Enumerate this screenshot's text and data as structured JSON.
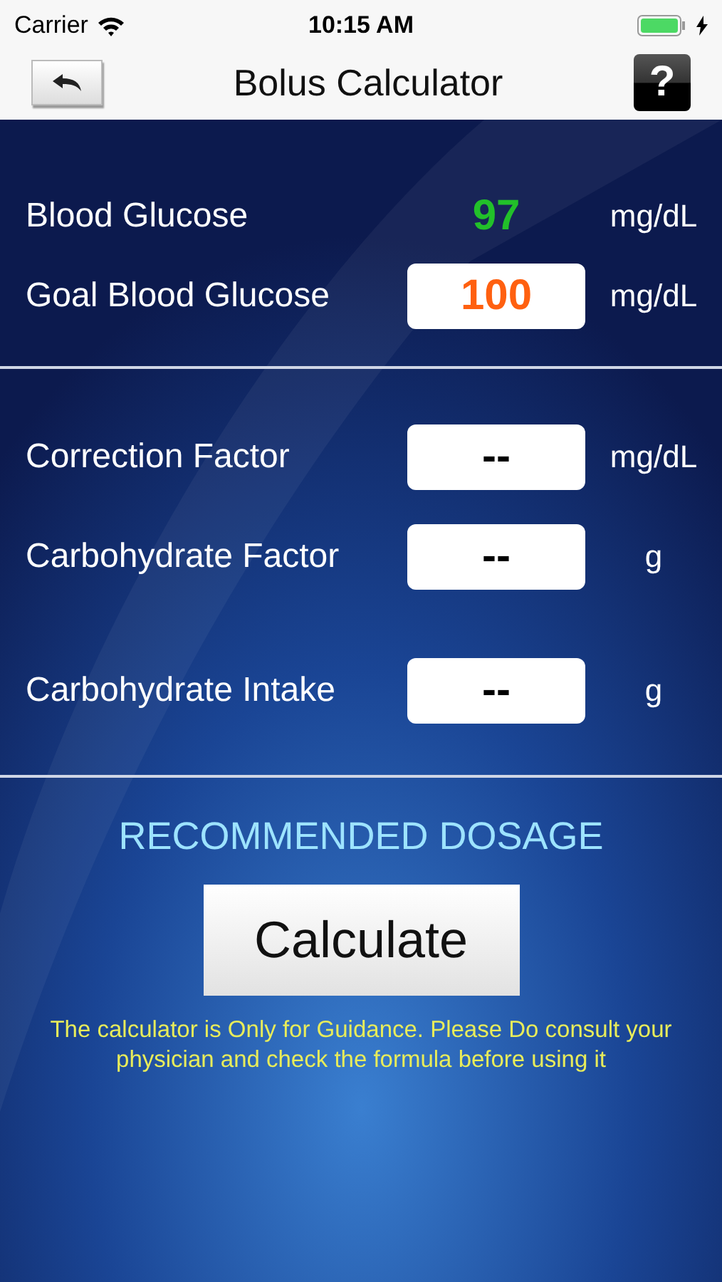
{
  "status_bar": {
    "carrier": "Carrier",
    "time": "10:15 AM",
    "charging": true
  },
  "nav_bar": {
    "title": "Bolus Calculator",
    "help": "?"
  },
  "sections": [
    {
      "rows": [
        {
          "label": "Blood Glucose",
          "kind": "plain",
          "value": "97",
          "color": "#22c02a",
          "unit": "mg/dL"
        },
        {
          "label": "Goal Blood Glucose",
          "kind": "field",
          "value": "100",
          "color": "#ff6010",
          "unit": "mg/dL"
        }
      ]
    },
    {
      "rows": [
        {
          "label": "Correction Factor",
          "kind": "field",
          "value": "--",
          "color": "#000000",
          "unit": "mg/dL"
        },
        {
          "label": "Carbohydrate Factor",
          "kind": "field",
          "value": "--",
          "color": "#000000",
          "unit": "g"
        },
        {
          "label": "Carbohydrate Intake",
          "kind": "field",
          "value": "--",
          "color": "#000000",
          "unit": "g"
        }
      ]
    }
  ],
  "result": {
    "heading": "RECOMMENDED DOSAGE",
    "button": "Calculate",
    "disclaimer": "The calculator is Only for Guidance. Please Do consult your physician and check the formula before using it"
  }
}
